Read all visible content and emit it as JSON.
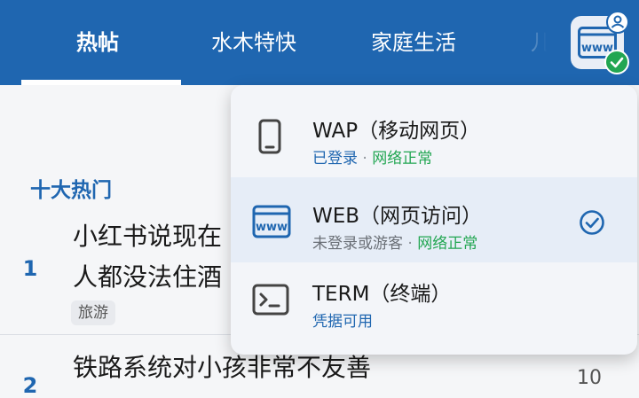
{
  "tabs": [
    {
      "label": "热帖",
      "active": true
    },
    {
      "label": "水木特快",
      "active": false
    },
    {
      "label": "家庭生活",
      "active": false
    },
    {
      "label": "儿",
      "active": false
    }
  ],
  "site_button": {
    "icon": "www-icon",
    "status": "check-badge",
    "accent": "#22a652"
  },
  "section": {
    "title": "十大热门"
  },
  "posts": [
    {
      "rank": "1",
      "title_lines": [
        "小红书说现在",
        "人都没法住酒"
      ],
      "tag": "旅游"
    },
    {
      "rank": "2",
      "title_lines": [
        "铁路系统对小孩非常不友善"
      ],
      "side": "10"
    }
  ],
  "menu": {
    "items": [
      {
        "icon": "phone-icon",
        "label": "WAP（移动网页）",
        "status": [
          {
            "text": "已登录",
            "color": "blue"
          },
          {
            "text": "网络正常",
            "color": "green"
          }
        ],
        "selected": false
      },
      {
        "icon": "www-icon",
        "label": "WEB（网页访问）",
        "status": [
          {
            "text": "未登录或游客",
            "color": "gray"
          },
          {
            "text": "网络正常",
            "color": "green"
          }
        ],
        "selected": true
      },
      {
        "icon": "terminal-icon",
        "label": "TERM（终端）",
        "status": [
          {
            "text": "凭据可用",
            "color": "blue"
          }
        ],
        "selected": false
      }
    ],
    "separator": "·"
  },
  "colors": {
    "primary": "#1f66b0",
    "green": "#22a652",
    "text": "#1a1a1a"
  }
}
